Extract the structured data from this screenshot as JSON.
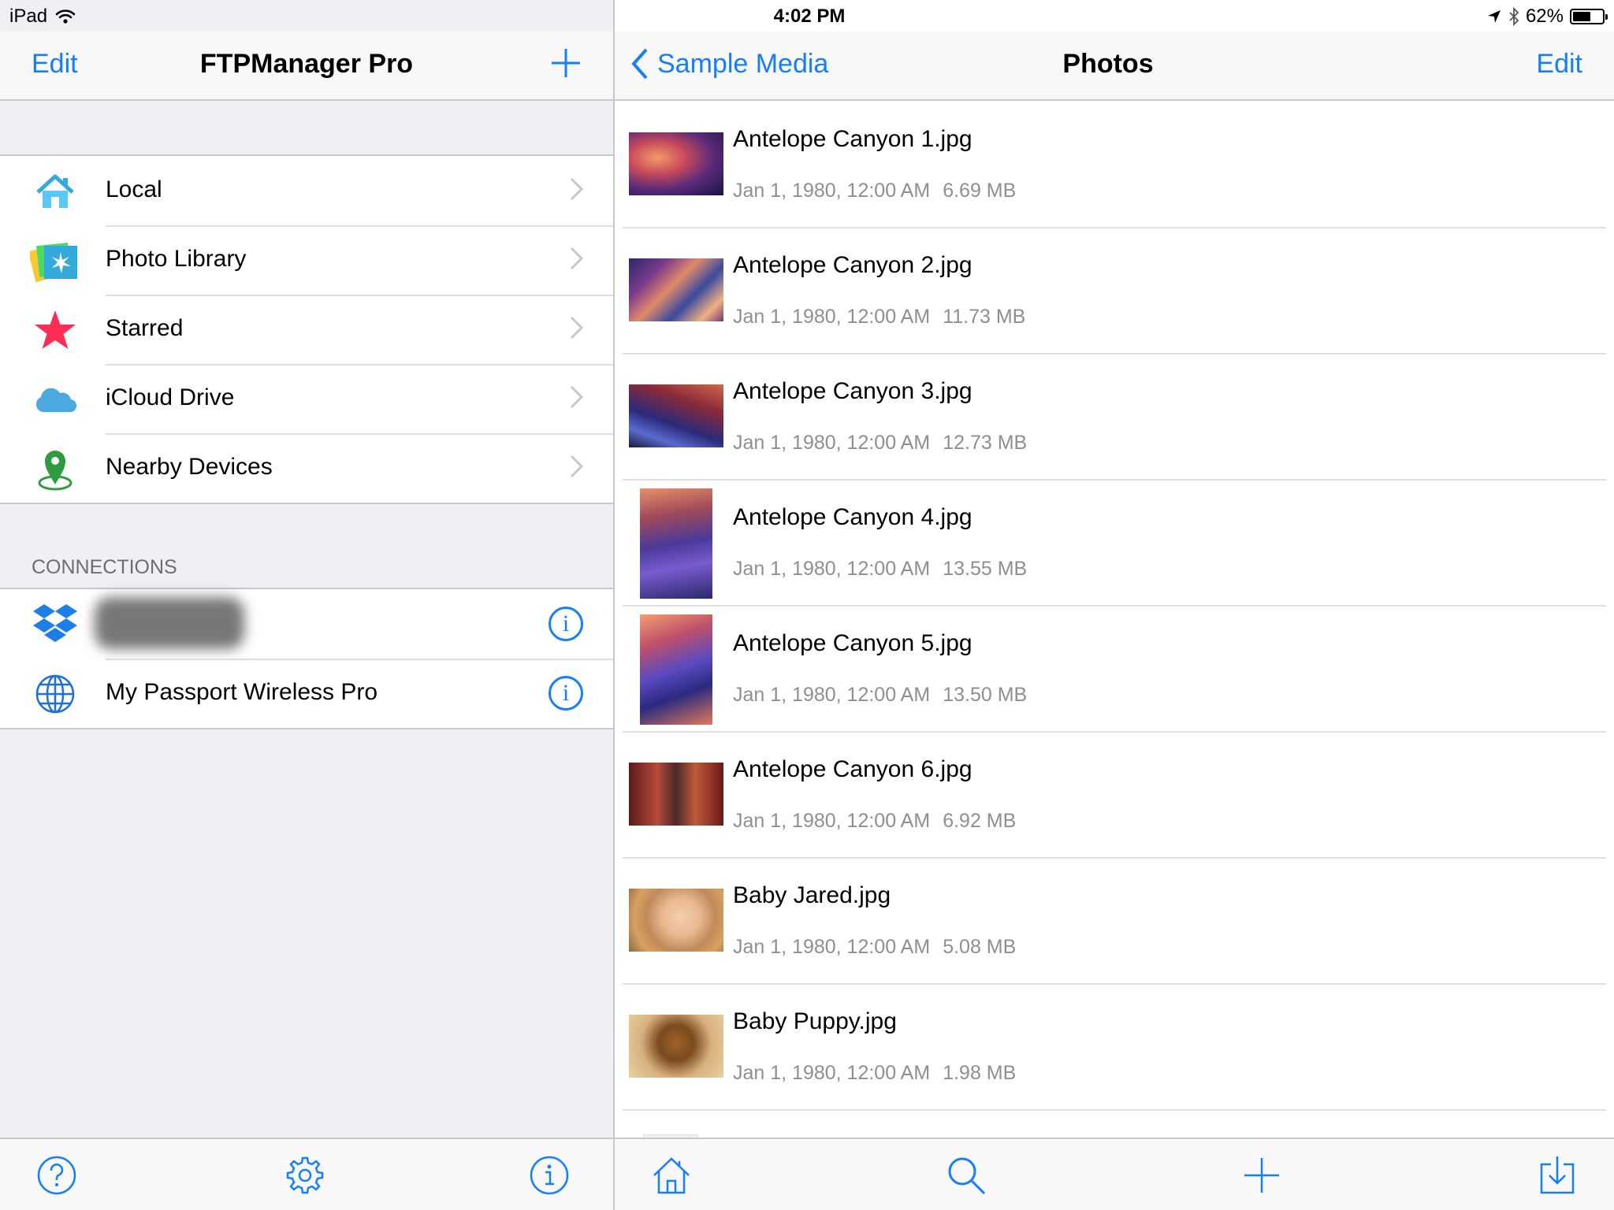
{
  "status_bar": {
    "device": "iPad",
    "time": "4:02 PM",
    "battery": "62%",
    "battery_level": 0.62
  },
  "sidebar": {
    "nav": {
      "edit": "Edit",
      "title": "FTPManager Pro"
    },
    "items": [
      {
        "label": "Local",
        "icon": "home-icon"
      },
      {
        "label": "Photo Library",
        "icon": "photo-library-icon"
      },
      {
        "label": "Starred",
        "icon": "star-icon"
      },
      {
        "label": "iCloud Drive",
        "icon": "cloud-icon"
      },
      {
        "label": "Nearby Devices",
        "icon": "location-pin-icon"
      }
    ],
    "connections_header": "CONNECTIONS",
    "connections": [
      {
        "label": "",
        "icon": "dropbox-icon"
      },
      {
        "label": "My Passport Wireless Pro",
        "icon": "globe-icon"
      }
    ]
  },
  "detail": {
    "nav": {
      "back": "Sample Media",
      "title": "Photos",
      "edit": "Edit"
    },
    "files": [
      {
        "name": "Antelope Canyon 1.jpg",
        "date": "Jan 1, 1980, 12:00 AM",
        "size": "6.69 MB"
      },
      {
        "name": "Antelope Canyon 2.jpg",
        "date": "Jan 1, 1980, 12:00 AM",
        "size": "11.73 MB"
      },
      {
        "name": "Antelope Canyon 3.jpg",
        "date": "Jan 1, 1980, 12:00 AM",
        "size": "12.73 MB"
      },
      {
        "name": "Antelope Canyon 4.jpg",
        "date": "Jan 1, 1980, 12:00 AM",
        "size": "13.55 MB"
      },
      {
        "name": "Antelope Canyon 5.jpg",
        "date": "Jan 1, 1980, 12:00 AM",
        "size": "13.50 MB"
      },
      {
        "name": "Antelope Canyon 6.jpg",
        "date": "Jan 1, 1980, 12:00 AM",
        "size": "6.92 MB"
      },
      {
        "name": "Baby Jared.jpg",
        "date": "Jan 1, 1980, 12:00 AM",
        "size": "5.08 MB"
      },
      {
        "name": "Baby Puppy.jpg",
        "date": "Jan 1, 1980, 12:00 AM",
        "size": "1.98 MB"
      }
    ]
  },
  "colors": {
    "accent": "#157efb",
    "star": "#fd2d55",
    "separator": "#c8c7cc"
  }
}
